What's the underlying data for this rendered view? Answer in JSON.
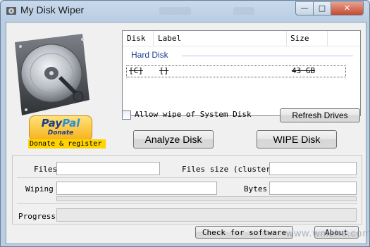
{
  "window": {
    "title": "My Disk Wiper",
    "controls": {
      "minimize": "—",
      "maximize": "□",
      "close": "✕"
    }
  },
  "paypal": {
    "logo_part1": "Pay",
    "logo_part2": "Pal",
    "logo_sub": "Donate"
  },
  "donate_label": "Donate & register",
  "disk_list": {
    "columns": [
      "Disk",
      "Label",
      "Size"
    ],
    "group": "Hard Disk",
    "rows": [
      {
        "disk": "[C]",
        "label": "[]",
        "size": "43 GB"
      }
    ]
  },
  "allow_wipe_label": "Allow wipe of System Disk",
  "buttons": {
    "refresh": "Refresh Drives",
    "analyze": "Analyze Disk",
    "wipe": "WIPE Disk",
    "check": "Check for software",
    "about": "About"
  },
  "stats": {
    "files_label": "Files",
    "files_value": "",
    "files_size_label": "Files size (cluster,",
    "files_size_value": "",
    "wiping_label": "Wiping",
    "wiping_value": "",
    "bytes_label": "Bytes",
    "bytes_value": "",
    "progress_label": "Progress"
  },
  "watermark": "www.wmzhe.com"
}
